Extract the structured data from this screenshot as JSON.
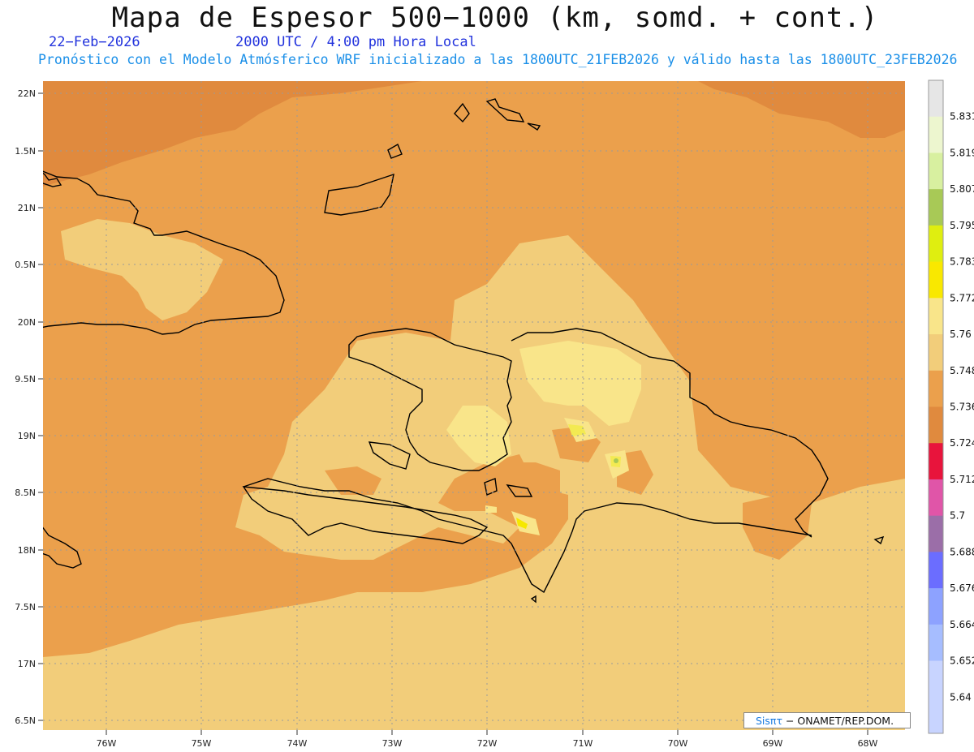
{
  "header": {
    "title": "Mapa de Espesor 500−1000 (km, somd. + cont.)",
    "date": "22−Feb−2026",
    "time": "2000 UTC / 4:00 pm Hora Local",
    "subtitle": "Pronóstico con el Modelo Atmósferico WRF inicializado a las 1800UTC_21FEB2026 y válido hasta las  1800UTC_23FEB2026"
  },
  "map": {
    "lat_labels": [
      "22N",
      "1.5N",
      "21N",
      "0.5N",
      "20N",
      "9.5N",
      "19N",
      "8.5N",
      "18N",
      "7.5N",
      "17N",
      "6.5N"
    ],
    "lon_labels": [
      "76W",
      "75W",
      "74W",
      "73W",
      "72W",
      "71W",
      "70W",
      "69W",
      "68W"
    ],
    "fill_colors": {
      "level_5712": "#e08a3e",
      "level_5724": "#eba04c",
      "level_5736": "#f2cd7a",
      "level_5748": "#f9e58a",
      "level_5760": "#f3ea52",
      "level_5772": "#f6e800"
    }
  },
  "colorbar": {
    "labels": [
      "5.831",
      "5.819",
      "5.807",
      "5.795",
      "5.783",
      "5.772",
      "5.76",
      "5.748",
      "5.736",
      "5.724",
      "5.712",
      "5.7",
      "5.688",
      "5.676",
      "5.664",
      "5.652",
      "5.64"
    ],
    "colors": [
      "#c8d4ff",
      "#a6bdff",
      "#8da2ff",
      "#6b6dff",
      "#9b6ea8",
      "#e055a8",
      "#e8143c",
      "#e08a3e",
      "#eba04c",
      "#f2cd7a",
      "#f9e58a",
      "#f9e800",
      "#dfee10",
      "#a8c956",
      "#d8f0a0",
      "#edf6cf",
      "#e6e6e6"
    ]
  },
  "credit": {
    "brand": "Sisπτ",
    "text": " − ONAMET/REP.DOM."
  }
}
